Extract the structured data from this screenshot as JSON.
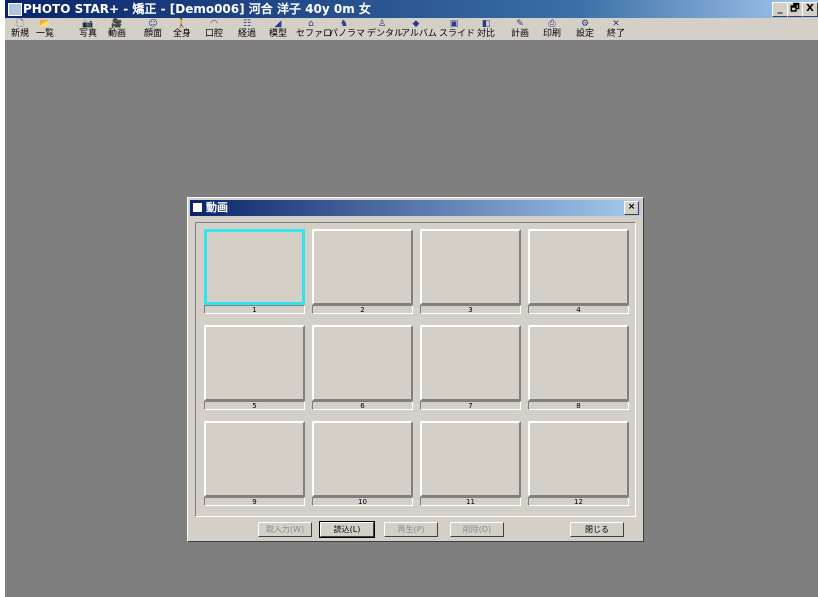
{
  "window": {
    "title": "PHOTO STAR+ - 矯正 - [Demo006]  河合  洋子  40y 0m  女",
    "min": "_",
    "max": "🗗",
    "close": "X"
  },
  "toolbar": [
    {
      "icon": "🗋",
      "icon_name": "new-icon",
      "label": "新規"
    },
    {
      "icon": "📂",
      "icon_name": "open-icon",
      "label": "一覧"
    },
    {
      "icon": "📷",
      "icon_name": "photo-icon",
      "label": "写真"
    },
    {
      "icon": "🎥",
      "icon_name": "video-icon",
      "label": "動画"
    },
    {
      "icon": "☺",
      "icon_name": "face-icon",
      "label": "顔面"
    },
    {
      "icon": "🚶",
      "icon_name": "body-icon",
      "label": "全身"
    },
    {
      "icon": "◠",
      "icon_name": "mouth-icon",
      "label": "口腔"
    },
    {
      "icon": "☷",
      "icon_name": "progress-icon",
      "label": "経過"
    },
    {
      "icon": "◢",
      "icon_name": "model-icon",
      "label": "模型"
    },
    {
      "icon": "⌂",
      "icon_name": "ceph-icon",
      "label": "セファロ"
    },
    {
      "icon": "♞",
      "icon_name": "panorama-icon",
      "label": "パノラマ"
    },
    {
      "icon": "♙",
      "icon_name": "dental-icon",
      "label": "デンタル"
    },
    {
      "icon": "◆",
      "icon_name": "album-icon",
      "label": "アルバム"
    },
    {
      "icon": "▣",
      "icon_name": "slide-icon",
      "label": "スライド"
    },
    {
      "icon": "◧",
      "icon_name": "compare-icon",
      "label": "対比"
    },
    {
      "icon": "✎",
      "icon_name": "plan-icon",
      "label": "計画"
    },
    {
      "icon": "⎙",
      "icon_name": "print-icon",
      "label": "印刷"
    },
    {
      "icon": "⚙",
      "icon_name": "settings-icon",
      "label": "設定"
    },
    {
      "icon": "✕",
      "icon_name": "exit-icon",
      "label": "終了"
    }
  ],
  "dialog": {
    "title": "動画",
    "close": "×",
    "slots": [
      "1",
      "2",
      "3",
      "4",
      "5",
      "6",
      "7",
      "8",
      "9",
      "10",
      "11",
      "12"
    ],
    "selected_slot": "1",
    "buttons": {
      "capture": "取入力(W)",
      "load": "読込(L)",
      "play": "再生(P)",
      "delete": "削除(D)",
      "close": "閉じる"
    }
  },
  "colors": {
    "selection": "#33e6ee",
    "workspace": "#7f7f7f",
    "face": "#d4d0c8"
  }
}
